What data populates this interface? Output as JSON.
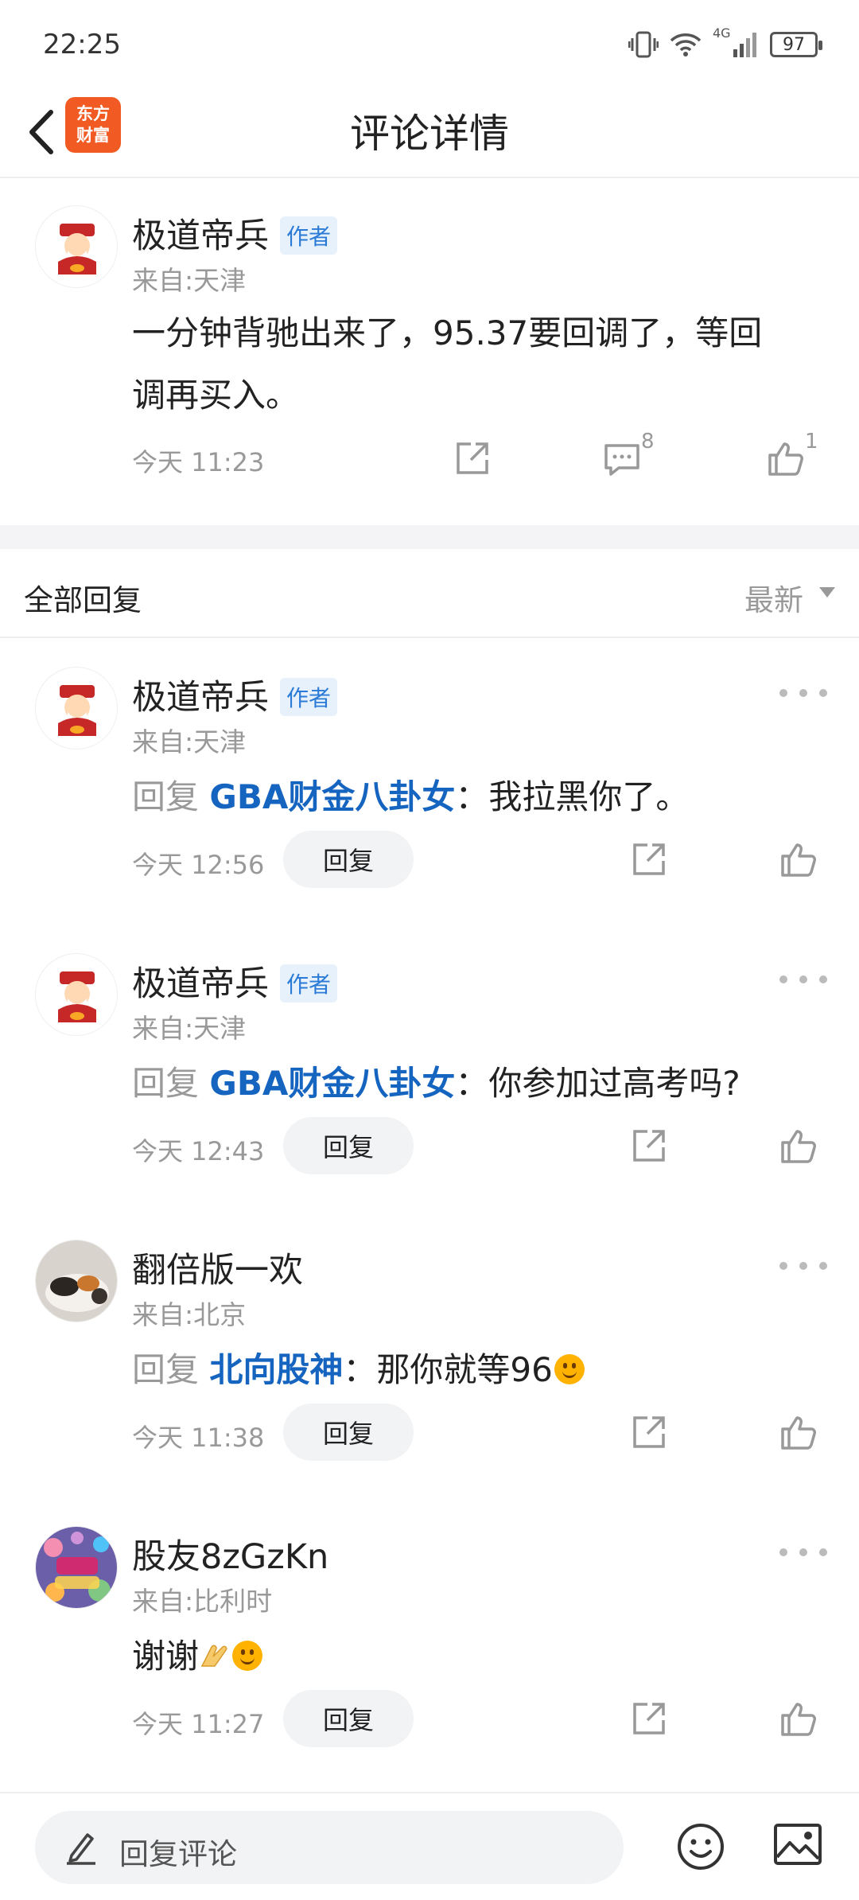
{
  "status_bar": {
    "time": "22:25",
    "battery": "97",
    "network": "4G"
  },
  "header": {
    "title": "评论详情",
    "logo_text_line1": "东方",
    "logo_text_line2": "财富"
  },
  "main_post": {
    "username": "极道帝兵",
    "tag": "作者",
    "from": "来自:天津",
    "text_line1": "一分钟背驰出来了，95.37要回调了，等回",
    "text_line2": "调再买入。",
    "time": "今天 11:23",
    "comment_count": "8",
    "like_count": "1"
  },
  "replies_header": {
    "label": "全部回复",
    "sort": "最新"
  },
  "replies": [
    {
      "username": "极道帝兵",
      "tag": "作者",
      "from": "来自:天津",
      "prefix": "回复 ",
      "target": "GBA财金八卦女",
      "text": "：我拉黑你了。",
      "time": "今天 12:56",
      "reply_label": "回复"
    },
    {
      "username": "极道帝兵",
      "tag": "作者",
      "from": "来自:天津",
      "prefix": "回复 ",
      "target": "GBA财金八卦女",
      "text": "：你参加过高考吗?",
      "time": "今天 12:43",
      "reply_label": "回复"
    },
    {
      "username": "翻倍版一欢",
      "tag": "",
      "from": "来自:北京",
      "prefix": "回复 ",
      "target": "北向股神",
      "text": "：那你就等96",
      "time": "今天 11:38",
      "reply_label": "回复"
    },
    {
      "username": "股友8zGzKn",
      "tag": "",
      "from": "来自:比利时",
      "prefix": "",
      "target": "",
      "text": "谢谢",
      "time": "今天 11:27",
      "reply_label": "回复"
    }
  ],
  "bottom_bar": {
    "placeholder": "回复评论"
  },
  "colors": {
    "accent_blue": "#1565c0",
    "brand_orange": "#f15a22",
    "tag_bg": "#e6f1fb"
  }
}
